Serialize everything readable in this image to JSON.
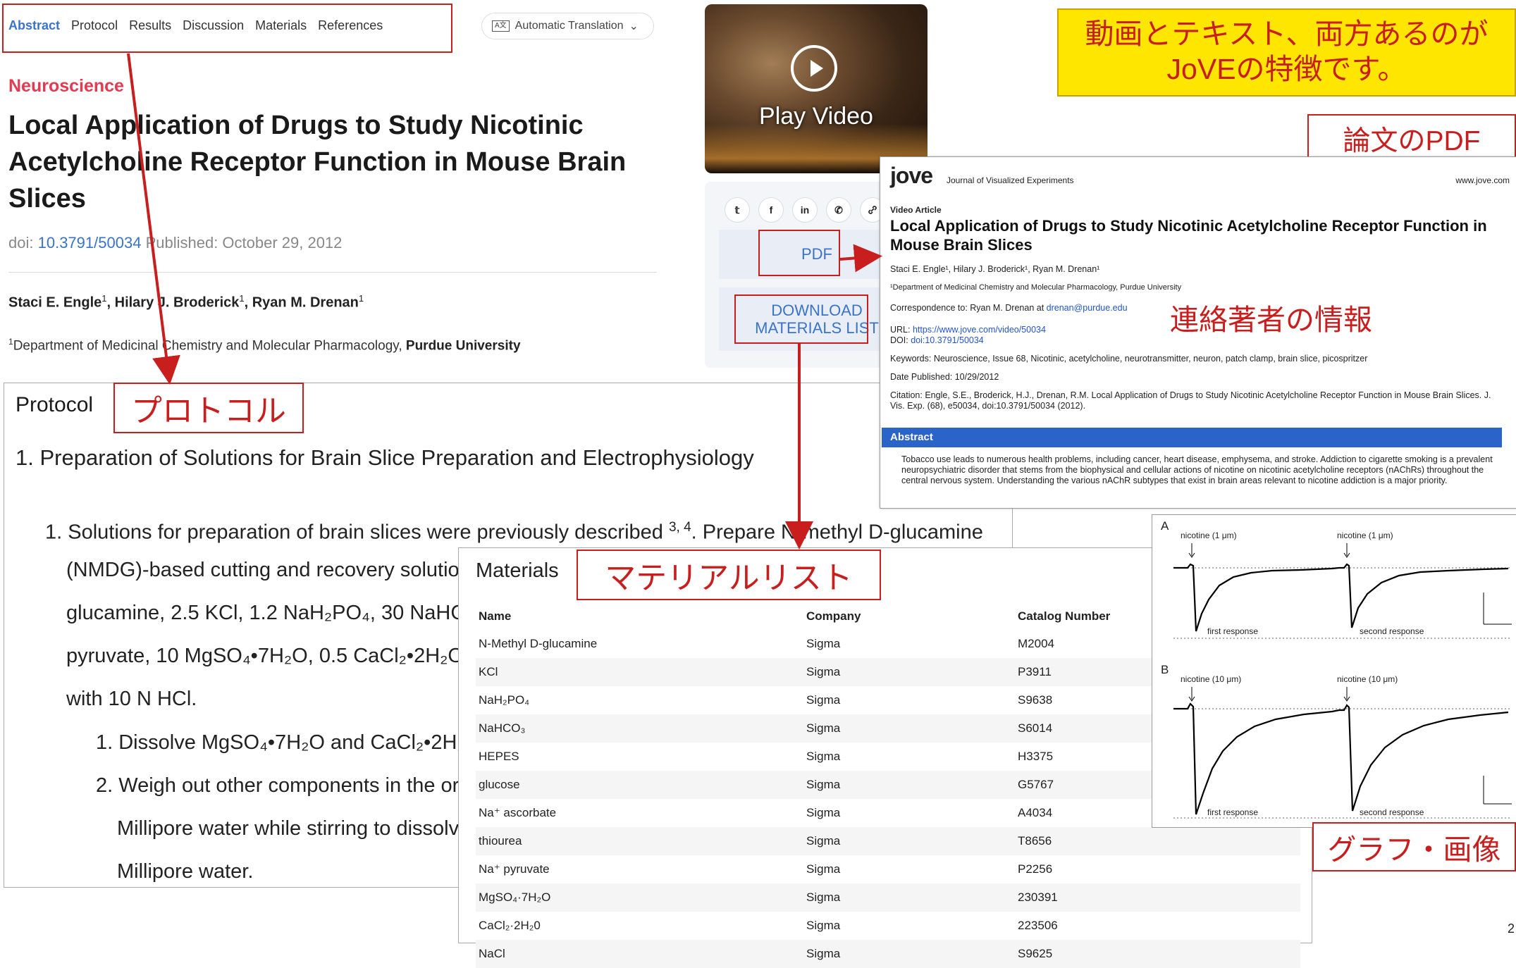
{
  "nav": {
    "tabs": [
      "Abstract",
      "Protocol",
      "Results",
      "Discussion",
      "Materials",
      "References"
    ],
    "auto_translation": "Automatic Translation"
  },
  "article": {
    "category": "Neuroscience",
    "title": "Local Application of Drugs to Study Nicotinic Acetylcholine Receptor Function in Mouse Brain Slices",
    "doi_label": "doi:",
    "doi": "10.3791/50034",
    "published": "Published: October 29, 2012",
    "authors": [
      {
        "name": "Staci E. Engle",
        "sup": "1"
      },
      {
        "name": "Hilary J. Broderick",
        "sup": "1"
      },
      {
        "name": "Ryan M. Drenan",
        "sup": "1"
      }
    ],
    "affiliation_sup": "1",
    "affiliation": "Department of Medicinal Chemistry and Molecular Pharmacology,",
    "affiliation_org": "Purdue University"
  },
  "video": {
    "label": "Play Video"
  },
  "side_tools": {
    "share_icons": [
      "twitter-icon",
      "facebook-icon",
      "linkedin-icon",
      "wechat-icon",
      "link-icon"
    ],
    "share_glyphs": [
      "𝕥",
      "f",
      "in",
      "✆",
      "🔗"
    ],
    "pdf_label": "PDF",
    "download_line1": "DOWNLOAD",
    "download_line2": "MATERIALS LIST"
  },
  "protocol": {
    "title": "Protocol",
    "step1": "1. Preparation of Solutions for Brain Slice Preparation and Electrophysiology",
    "step1_1_a": "1. Solutions for preparation of brain slices were previously described",
    "step1_1_refs": "3, 4",
    "step1_1_b": ". Prepare N-methyl D-glucamine",
    "line2": "(NMDG)-based cutting and recovery solutio",
    "line3": "glucamine, 2.5 KCl, 1.2 NaH₂PO₄, 30 NaHCO",
    "line4": "pyruvate, 10 MgSO₄•7H₂O, 0.5 CaCl₂•2H₂O.",
    "line5": "with 10 N HCl.",
    "sub1": "1. Dissolve MgSO₄•7H₂O and CaCl₂•2H₂",
    "sub2": "2. Weigh out other components in the or",
    "sub2_b": "Millipore water while stirring to dissolv",
    "sub2_c": "Millipore water."
  },
  "callouts": {
    "yellow_line1": "動画とテキスト、両方あるのが",
    "yellow_line2": "JoVEの特徴です。",
    "pdf_paper": "論文のPDF",
    "protocol": "プロトコル",
    "materials": "マテリアルリスト",
    "contact": "連絡著者の情報",
    "graphs": "グラフ・画像"
  },
  "materials": {
    "title": "Materials",
    "headers": [
      "Name",
      "Company",
      "Catalog Number"
    ],
    "rows": [
      [
        "N-Methyl D-glucamine",
        "Sigma",
        "M2004"
      ],
      [
        "KCl",
        "Sigma",
        "P3911"
      ],
      [
        "NaH₂PO₄",
        "Sigma",
        "S9638"
      ],
      [
        "NaHCO₃",
        "Sigma",
        "S6014"
      ],
      [
        "HEPES",
        "Sigma",
        "H3375"
      ],
      [
        "glucose",
        "Sigma",
        "G5767"
      ],
      [
        "Na⁺ ascorbate",
        "Sigma",
        "A4034"
      ],
      [
        "thiourea",
        "Sigma",
        "T8656"
      ],
      [
        "Na⁺ pyruvate",
        "Sigma",
        "P2256"
      ],
      [
        "MgSO₄·7H₂O",
        "Sigma",
        "230391"
      ],
      [
        "CaCl₂·2H₂0",
        "Sigma",
        "223506"
      ],
      [
        "NaCl",
        "Sigma",
        "S9625"
      ]
    ]
  },
  "pdf": {
    "logo": "jove",
    "journal": "Journal of Visualized Experiments",
    "site": "www.jove.com",
    "kind": "Video Article",
    "title": "Local Application of Drugs to Study Nicotinic Acetylcholine Receptor Function in Mouse Brain Slices",
    "authors": "Staci E. Engle¹, Hilary J. Broderick¹, Ryan M. Drenan¹",
    "affiliation": "¹Department of Medicinal Chemistry and Molecular Pharmacology, Purdue University",
    "correspondence": "Correspondence to: Ryan M. Drenan at",
    "email": "drenan@purdue.edu",
    "url_label": "URL:",
    "url": "https://www.jove.com/video/50034",
    "doi_label": "DOI:",
    "doi": "doi:10.3791/50034",
    "keywords": "Keywords: Neuroscience, Issue 68, Nicotinic, acetylcholine, neurotransmitter, neuron, patch clamp, brain slice, picospritzer",
    "date": "Date Published: 10/29/2012",
    "citation": "Citation: Engle, S.E., Broderick, H.J., Drenan, R.M. Local Application of Drugs to Study Nicotinic Acetylcholine Receptor Function in Mouse Brain Slices. J. Vis. Exp. (68), e50034, doi:10.3791/50034 (2012).",
    "abstract_label": "Abstract",
    "abstract": "Tobacco use leads to numerous health problems, including cancer, heart disease, emphysema, and stroke. Addiction to cigarette smoking is a prevalent neuropsychiatric disorder that stems from the biophysical and cellular actions of nicotine on nicotinic acetylcholine receptors (nAChRs) throughout the central nervous system. Understanding the various nAChR subtypes that exist in brain areas relevant to nicotine addiction is a major priority."
  },
  "figure": {
    "panel_a": "A",
    "panel_b": "B",
    "a_left": "nicotine (1 μm)",
    "a_right": "nicotine (1 μm)",
    "b_left": "nicotine (10 μm)",
    "b_right": "nicotine (10 μm)",
    "first": "first response",
    "second": "second response"
  },
  "page_number": "2"
}
